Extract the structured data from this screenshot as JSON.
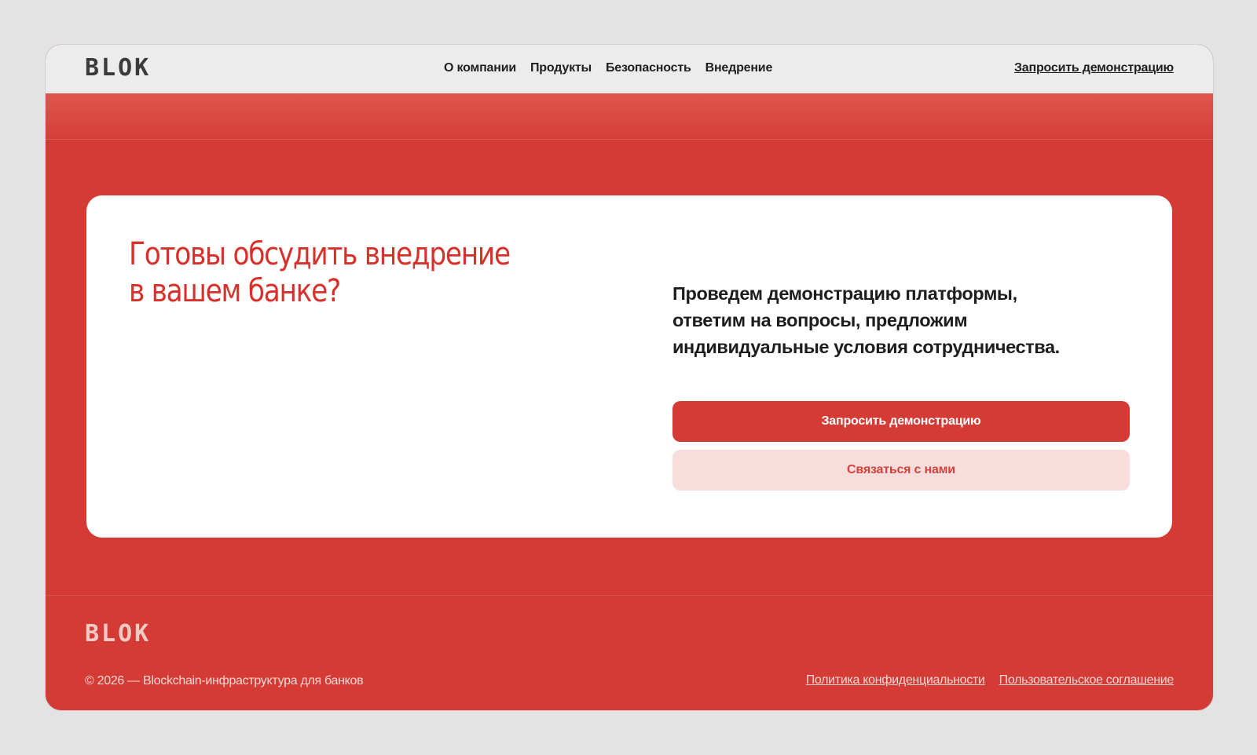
{
  "header": {
    "logo": "BLOK",
    "nav": [
      "О компании",
      "Продукты",
      "Безопасность",
      "Внедрение"
    ],
    "cta_label": "Запросить демонстрацию"
  },
  "cta_section": {
    "title": "Готовы обсудить внедрение\nв вашем банке?",
    "description": "Проведем демонстрацию платформы,\nответим на вопросы, предложим\nиндивидуальные условия сотрудничества.",
    "primary_button": "Запросить демонстрацию",
    "secondary_button": "Связаться с нами"
  },
  "footer": {
    "logo": "BLOK",
    "copyright": "© 2026 — Blockchain-инфраструктура для банков",
    "links": [
      "Политика конфиденциальности",
      "Пользовательское соглашение"
    ]
  },
  "colors": {
    "brand_red": "#d43b35",
    "header_bg": "#ececec",
    "secondary_button_bg": "#f8dddd"
  }
}
